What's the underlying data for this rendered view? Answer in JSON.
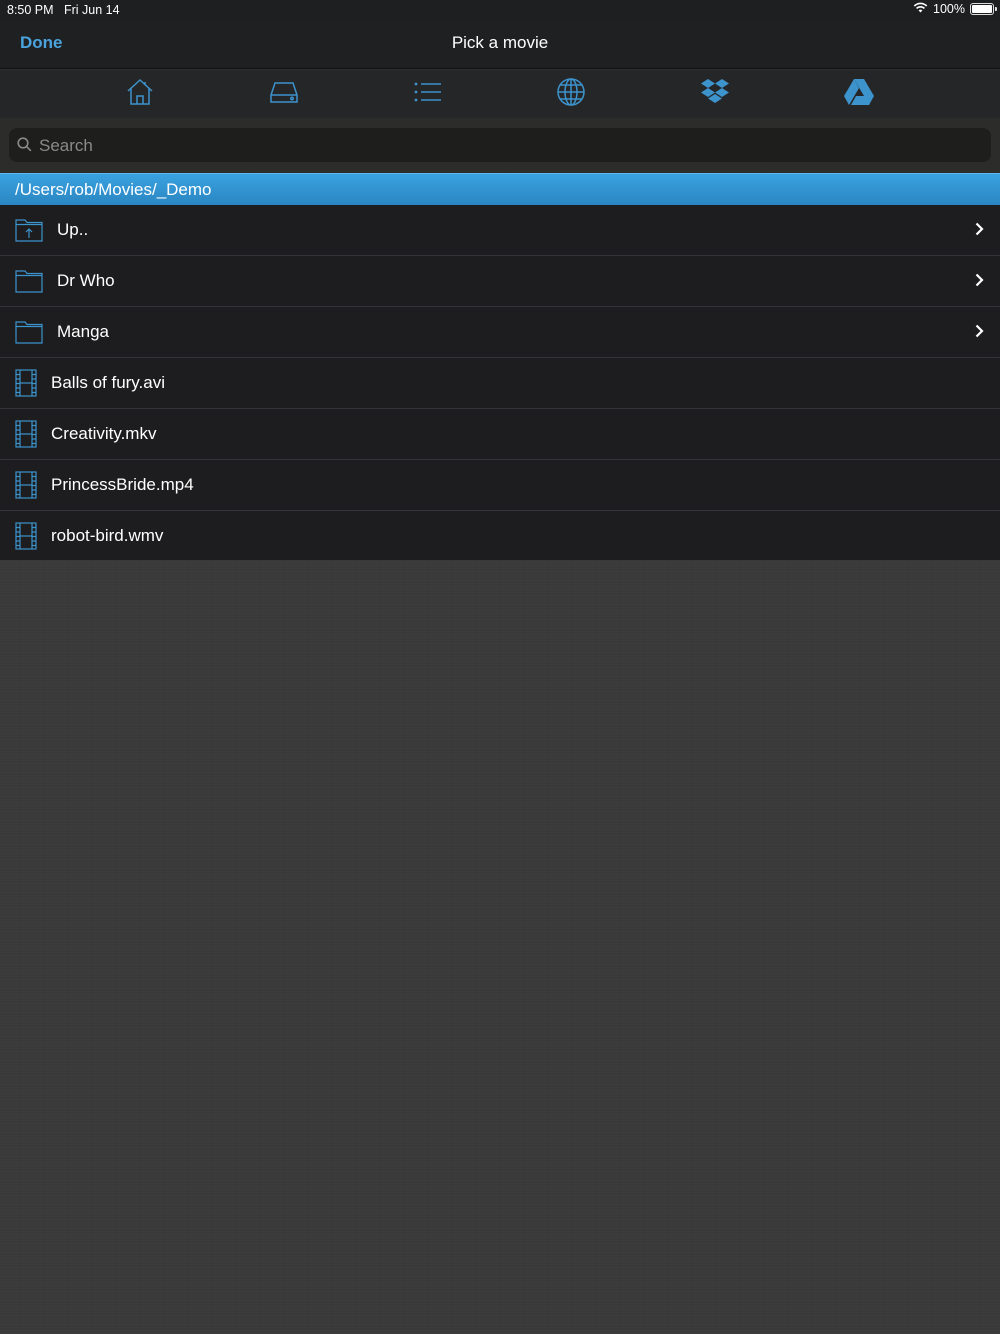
{
  "status": {
    "time": "8:50 PM",
    "date": "Fri Jun 14",
    "battery": "100%"
  },
  "nav": {
    "done_label": "Done",
    "title": "Pick a movie"
  },
  "toolbar": {
    "icons": [
      "home-icon",
      "drive-icon",
      "list-icon",
      "globe-icon",
      "dropbox-icon",
      "google-drive-icon"
    ]
  },
  "search": {
    "placeholder": "Search",
    "value": ""
  },
  "path": "/Users/rob/Movies/_Demo",
  "items": [
    {
      "label": "Up..",
      "type": "folder-up"
    },
    {
      "label": "Dr Who",
      "type": "folder"
    },
    {
      "label": "Manga",
      "type": "folder"
    },
    {
      "label": "Balls of fury.avi",
      "type": "file"
    },
    {
      "label": "Creativity.mkv",
      "type": "file"
    },
    {
      "label": "PrincessBride.mp4",
      "type": "file"
    },
    {
      "label": "robot-bird.wmv",
      "type": "file"
    }
  ],
  "colors": {
    "accent": "#4aa3dc",
    "path_bar": "#2f93d1",
    "row_bg": "#1d1d1f",
    "background": "#3a3a3a"
  }
}
